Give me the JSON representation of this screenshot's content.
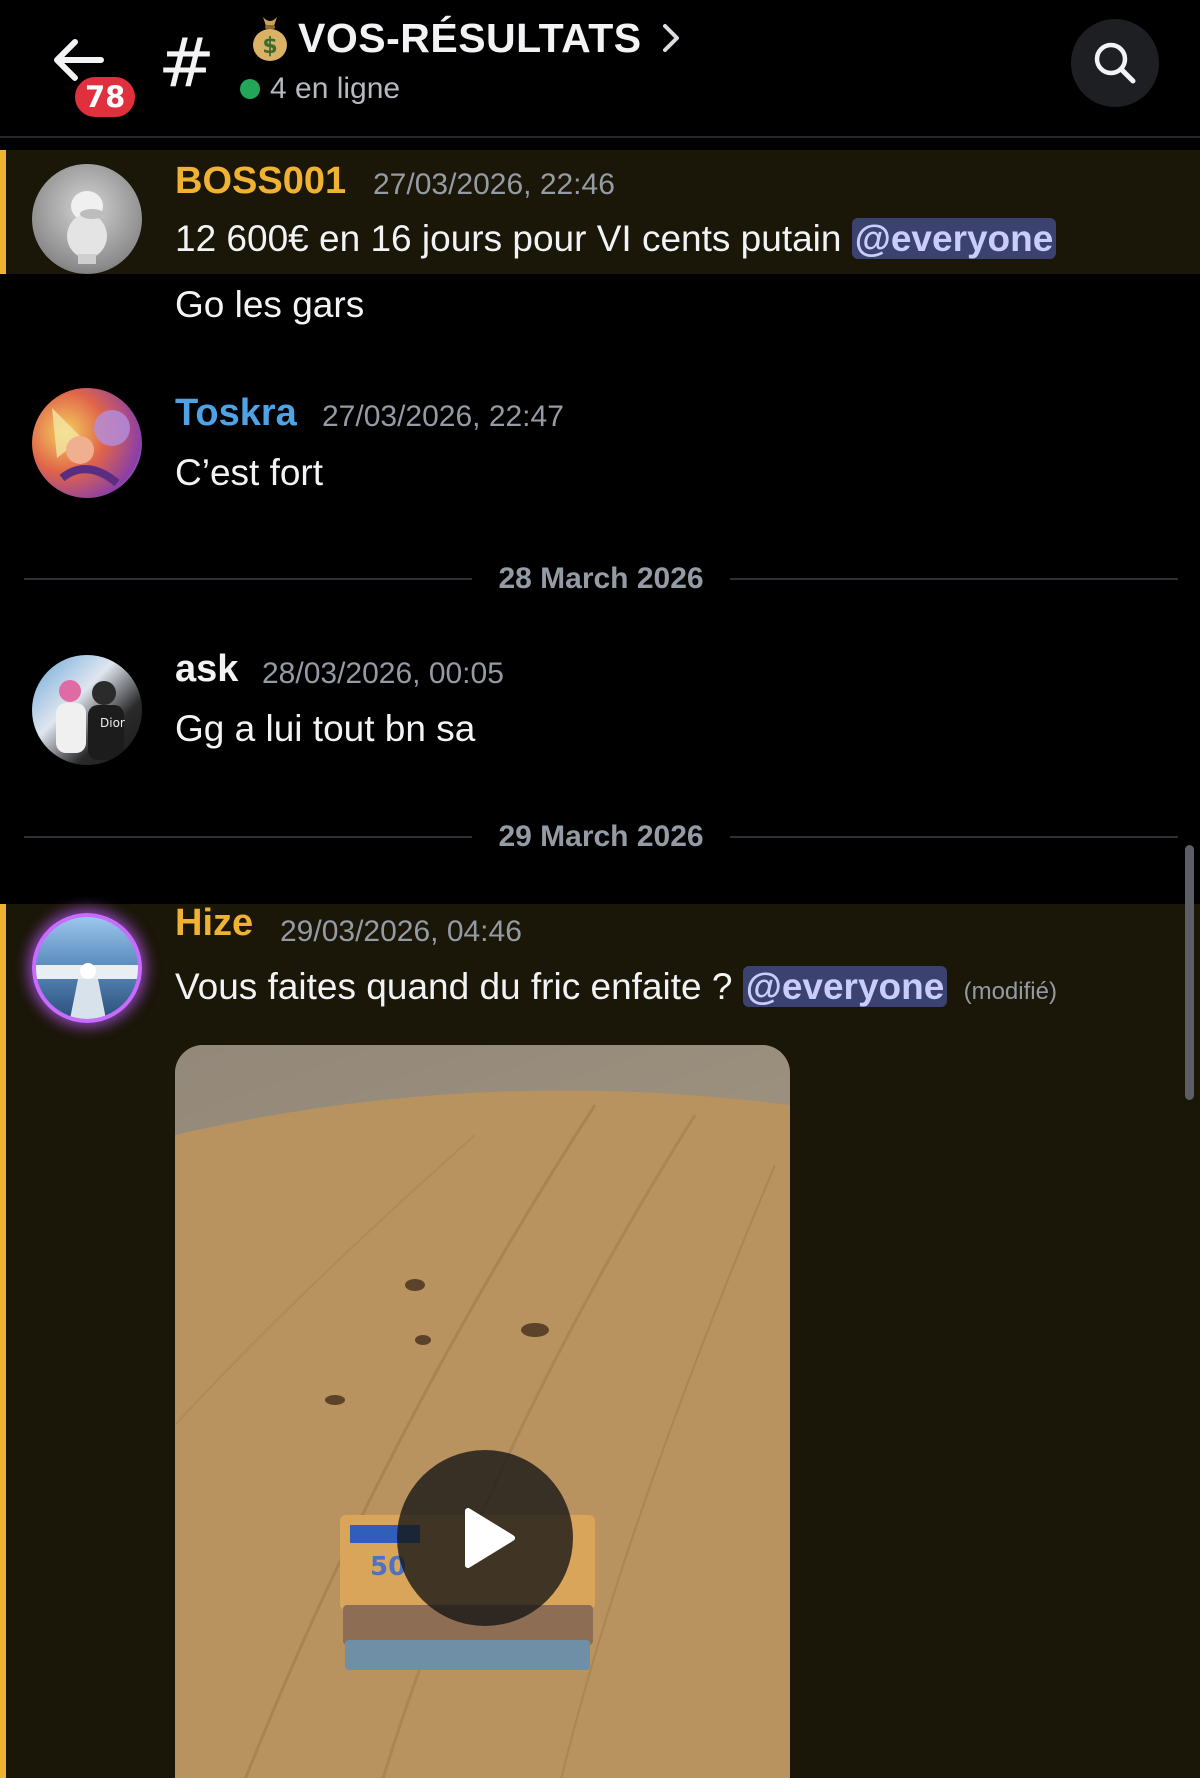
{
  "header": {
    "unread_count": "78",
    "channel_hash": "#",
    "channel_name": "VOS-RÉSULTATS",
    "online_status": "4 en ligne",
    "icons": [
      "back-arrow-icon",
      "moneybag-icon",
      "chevron-right-icon",
      "search-icon"
    ]
  },
  "messages": [
    {
      "username": "BOSS001",
      "username_color": "#f0b232",
      "timestamp": "27/03/2026, 22:46",
      "text": "12 600€ en 16 jours pour VI cents putain",
      "mention": "@everyone",
      "highlighted": true,
      "followup": "Go les gars"
    },
    {
      "username": "Toskra",
      "username_color": "#4da3e6",
      "timestamp": "27/03/2026, 22:47",
      "text": "C’est fort"
    },
    {
      "username": "ask",
      "username_color": "#f2f3f5",
      "timestamp": "28/03/2026, 00:05",
      "text": "Gg a lui tout bn sa"
    },
    {
      "username": "Hize",
      "username_color": "#f0b232",
      "timestamp": "29/03/2026, 04:46",
      "text": "Vous faites quand du fric enfaite ?",
      "mention": "@everyone",
      "edited": "(modifié)",
      "highlighted": true,
      "attachment": "video"
    }
  ],
  "dividers": [
    "28 March 2026",
    "29 March 2026"
  ],
  "colors": {
    "accent_mention_bg": "#3c4270",
    "highlight_border": "#f0b232",
    "online": "#23a55a",
    "badge": "#e02f3d"
  }
}
